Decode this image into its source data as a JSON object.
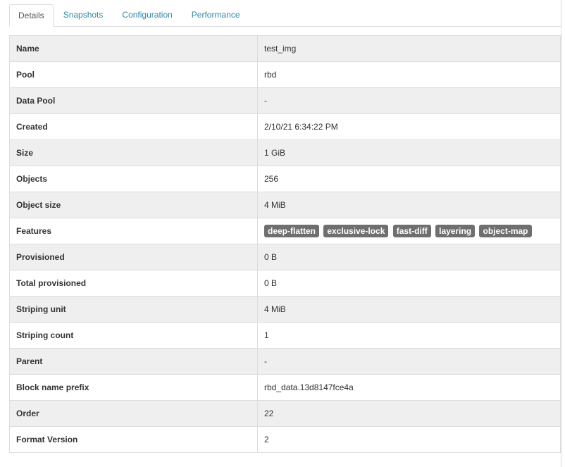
{
  "tabs": [
    {
      "label": "Details",
      "active": true
    },
    {
      "label": "Snapshots",
      "active": false
    },
    {
      "label": "Configuration",
      "active": false
    },
    {
      "label": "Performance",
      "active": false
    }
  ],
  "details": {
    "name": {
      "label": "Name",
      "value": "test_img"
    },
    "pool": {
      "label": "Pool",
      "value": "rbd"
    },
    "data_pool": {
      "label": "Data Pool",
      "value": "-"
    },
    "created": {
      "label": "Created",
      "value": "2/10/21 6:34:22 PM"
    },
    "size": {
      "label": "Size",
      "value": "1 GiB"
    },
    "objects": {
      "label": "Objects",
      "value": "256"
    },
    "object_size": {
      "label": "Object size",
      "value": "4 MiB"
    },
    "features": {
      "label": "Features",
      "badges": [
        "deep-flatten",
        "exclusive-lock",
        "fast-diff",
        "layering",
        "object-map"
      ]
    },
    "provisioned": {
      "label": "Provisioned",
      "value": "0 B"
    },
    "total_provisioned": {
      "label": "Total provisioned",
      "value": "0 B"
    },
    "striping_unit": {
      "label": "Striping unit",
      "value": "4 MiB"
    },
    "striping_count": {
      "label": "Striping count",
      "value": "1"
    },
    "parent": {
      "label": "Parent",
      "value": "-"
    },
    "block_name_prefix": {
      "label": "Block name prefix",
      "value": "rbd_data.13d8147fce4a"
    },
    "order": {
      "label": "Order",
      "value": "22"
    },
    "format_version": {
      "label": "Format Version",
      "value": "2"
    }
  },
  "colors": {
    "tab_link": "#2f8aa8",
    "badge_bg": "#6f6f6f",
    "row_stripe": "#efefef",
    "border": "#dddddd"
  }
}
